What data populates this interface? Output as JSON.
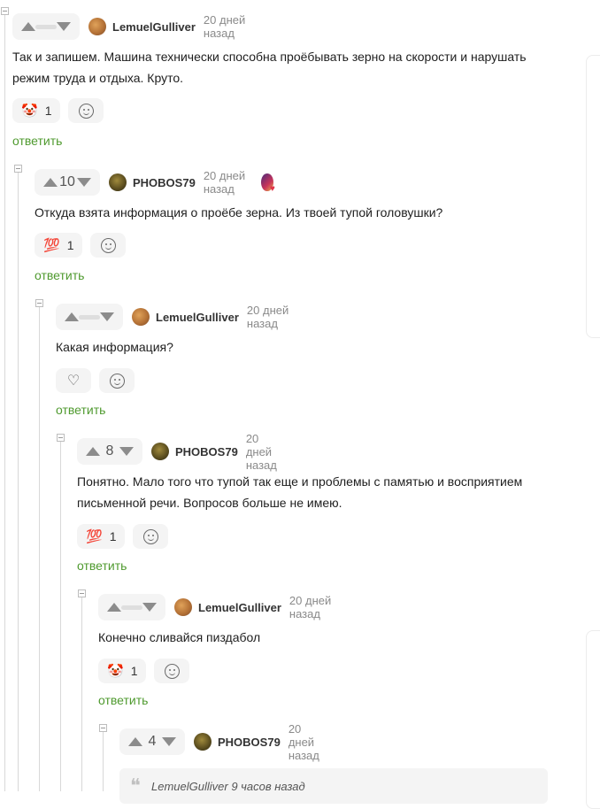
{
  "comments": [
    {
      "author": "LemuelGulliver",
      "time": "20 дней назад",
      "score": "",
      "rating_fraction": 0.35,
      "text_lines": [
        "Так и запишем. Машина технически способна проёбывать зерно на скорости и нарушать",
        "режим труда и отдыха. Круто."
      ],
      "reaction": {
        "emoji": "🤡",
        "count": "1"
      },
      "reply_label": "ответить",
      "avatar_icon": "user-avatar-icon"
    },
    {
      "author": "PHOBOS79",
      "time": "20 дней назад",
      "score": "10",
      "text_lines": [
        "Откуда взята информация о проёбе зерна. Из твоей тупой головушки?"
      ],
      "reaction": {
        "emoji": "💯",
        "count": "1"
      },
      "reply_label": "ответить",
      "avatar_icon": "user-avatar-icon",
      "award_icon": "award-badge-icon"
    },
    {
      "author": "LemuelGulliver",
      "time": "20 дней назад",
      "score": "",
      "rating_fraction": 1.0,
      "text_lines": [
        "Какая информация?"
      ],
      "reaction": {
        "emoji": "",
        "count": ""
      },
      "reply_label": "ответить",
      "avatar_icon": "user-avatar-icon"
    },
    {
      "author": "PHOBOS79",
      "time": "20 дней назад",
      "score": "8",
      "text_lines": [
        "Понятно. Мало того что тупой так еще и проблемы с памятью и восприятием",
        "письменной речи. Вопросов больше не имею."
      ],
      "reaction": {
        "emoji": "💯",
        "count": "1"
      },
      "reply_label": "ответить",
      "avatar_icon": "user-avatar-icon"
    },
    {
      "author": "LemuelGulliver",
      "time": "20 дней назад",
      "score": "",
      "rating_fraction": 0.7,
      "text_lines": [
        "Конечно сливайся пиздабол"
      ],
      "reaction": {
        "emoji": "🤡",
        "count": "1"
      },
      "reply_label": "ответить",
      "avatar_icon": "user-avatar-icon"
    },
    {
      "author": "PHOBOS79",
      "time": "20 дней назад",
      "score": "4",
      "quote": {
        "author": "LemuelGulliver",
        "time": "9 часов назад"
      },
      "avatar_icon": "user-avatar-icon"
    }
  ],
  "colors": {
    "reply": "#4f9a2f",
    "rating_negative": "#e35d5d",
    "vote_bg": "#f4f4f4"
  }
}
